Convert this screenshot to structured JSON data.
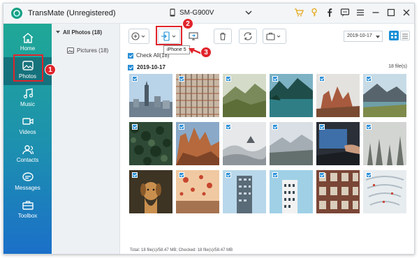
{
  "app": {
    "title": "TransMate (Unregistered)",
    "device": "SM-G900V"
  },
  "sidebar": {
    "items": [
      {
        "label": "Home",
        "icon": "home-icon"
      },
      {
        "label": "Photos",
        "icon": "photo-icon"
      },
      {
        "label": "Music",
        "icon": "music-icon"
      },
      {
        "label": "Videos",
        "icon": "video-icon"
      },
      {
        "label": "Contacts",
        "icon": "contacts-icon"
      },
      {
        "label": "Messages",
        "icon": "messages-icon"
      },
      {
        "label": "Toolbox",
        "icon": "toolbox-icon"
      }
    ]
  },
  "tree": {
    "all_label": "All Photos (18)",
    "pictures_label": "Pictures (18)"
  },
  "toolbar": {
    "date_value": "2019-10-17",
    "tooltip": "iPhone 5"
  },
  "main": {
    "check_all_label": "Check All(18)",
    "group_date": "2019-10-17",
    "group_count": "18 file(s)",
    "status": "Total: 18 file(s)/58.47 MB; Checked: 18 file(s)/58.47 MB"
  },
  "annotations": [
    "1",
    "2",
    "3"
  ],
  "colors": {
    "accent": "#1a8fd6",
    "annotation_red": "#e0242b",
    "sidebar_top": "#1fa896",
    "sidebar_bottom": "#1b6fc9"
  }
}
